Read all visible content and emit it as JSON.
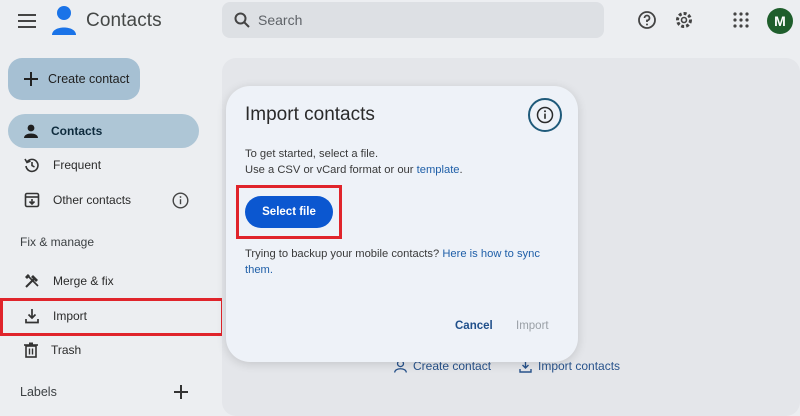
{
  "app": {
    "title": "Contacts"
  },
  "header": {
    "search_placeholder": "Search",
    "avatar_letter": "M"
  },
  "sidebar": {
    "create_label": "Create contact",
    "items": [
      {
        "label": "Contacts",
        "icon": "person-icon",
        "active": true
      },
      {
        "label": "Frequent",
        "icon": "history-icon"
      },
      {
        "label": "Other contacts",
        "icon": "archive-down-icon"
      }
    ],
    "fix_manage_heading": "Fix & manage",
    "manage_items": [
      {
        "label": "Merge & fix",
        "icon": "tools-icon"
      },
      {
        "label": "Import",
        "icon": "download-icon",
        "highlighted": true
      },
      {
        "label": "Trash",
        "icon": "trash-icon"
      }
    ],
    "labels_heading": "Labels"
  },
  "background": {
    "create_contact_link": "Create contact",
    "import_contacts_link": "Import contacts"
  },
  "dialog": {
    "title": "Import contacts",
    "intro_line1": "To get started, select a file.",
    "intro_line2_prefix": "Use a CSV or vCard format or our ",
    "intro_line2_link": "template",
    "intro_line2_suffix": ".",
    "select_file_label": "Select file",
    "backup_prefix": "Trying to backup your mobile contacts? ",
    "backup_link_1": "Here is how to sync",
    "backup_link_2": "them.",
    "cancel_label": "Cancel",
    "import_label": "Import"
  },
  "colors": {
    "accent": "#0b57d0",
    "highlight_box": "#e0242b",
    "active_nav": "#aec6d6"
  }
}
